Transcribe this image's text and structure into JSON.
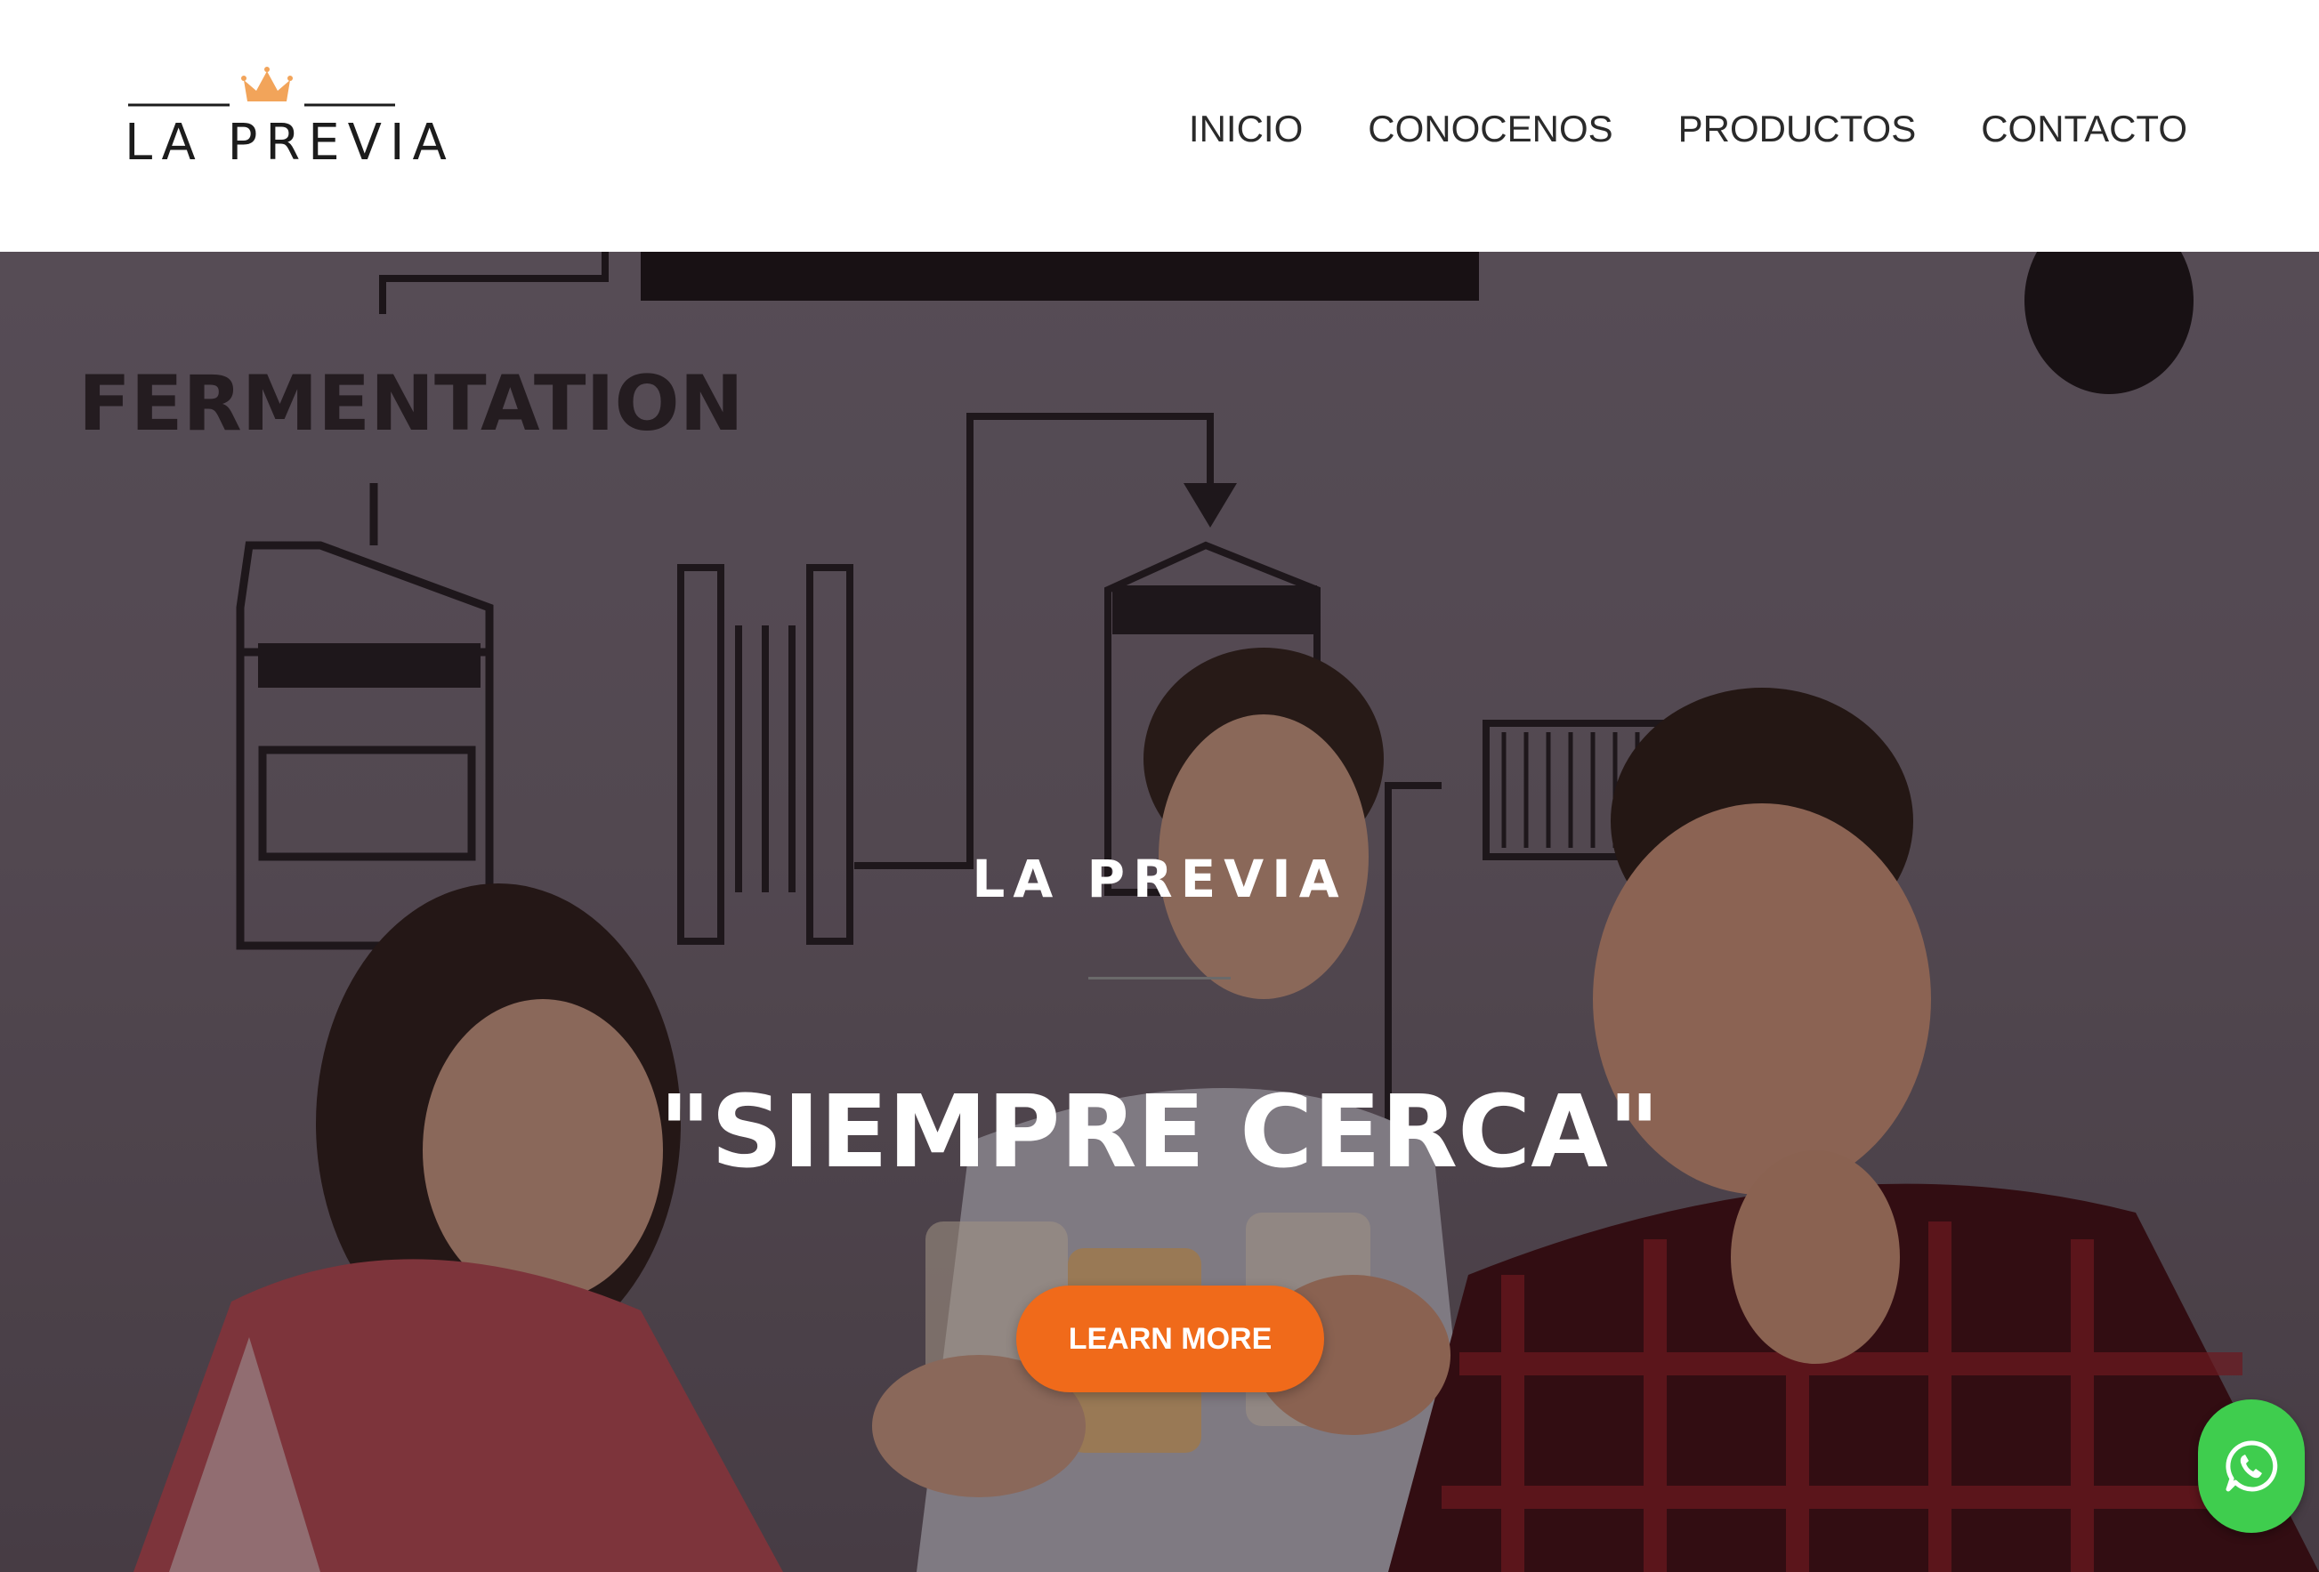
{
  "header": {
    "logo_text": "LA PREVIA",
    "logo_icon": "crown-icon",
    "nav": [
      {
        "label": "INICIO"
      },
      {
        "label": "CONOCENOS"
      },
      {
        "label": "PRODUCTOS"
      },
      {
        "label": "CONTACTO"
      }
    ]
  },
  "hero": {
    "wall_text": "FERMENTATION",
    "subtitle": "LA PREVIA",
    "title": "\"SIEMPRE CERCA\"",
    "cta_label": "LEARN MORE"
  },
  "floating": {
    "whatsapp_icon": "whatsapp-icon"
  },
  "colors": {
    "accent": "#f06a1a",
    "crown": "#f2a45a",
    "whatsapp": "#3fcd4e",
    "nav_text": "#2a2a2a"
  }
}
